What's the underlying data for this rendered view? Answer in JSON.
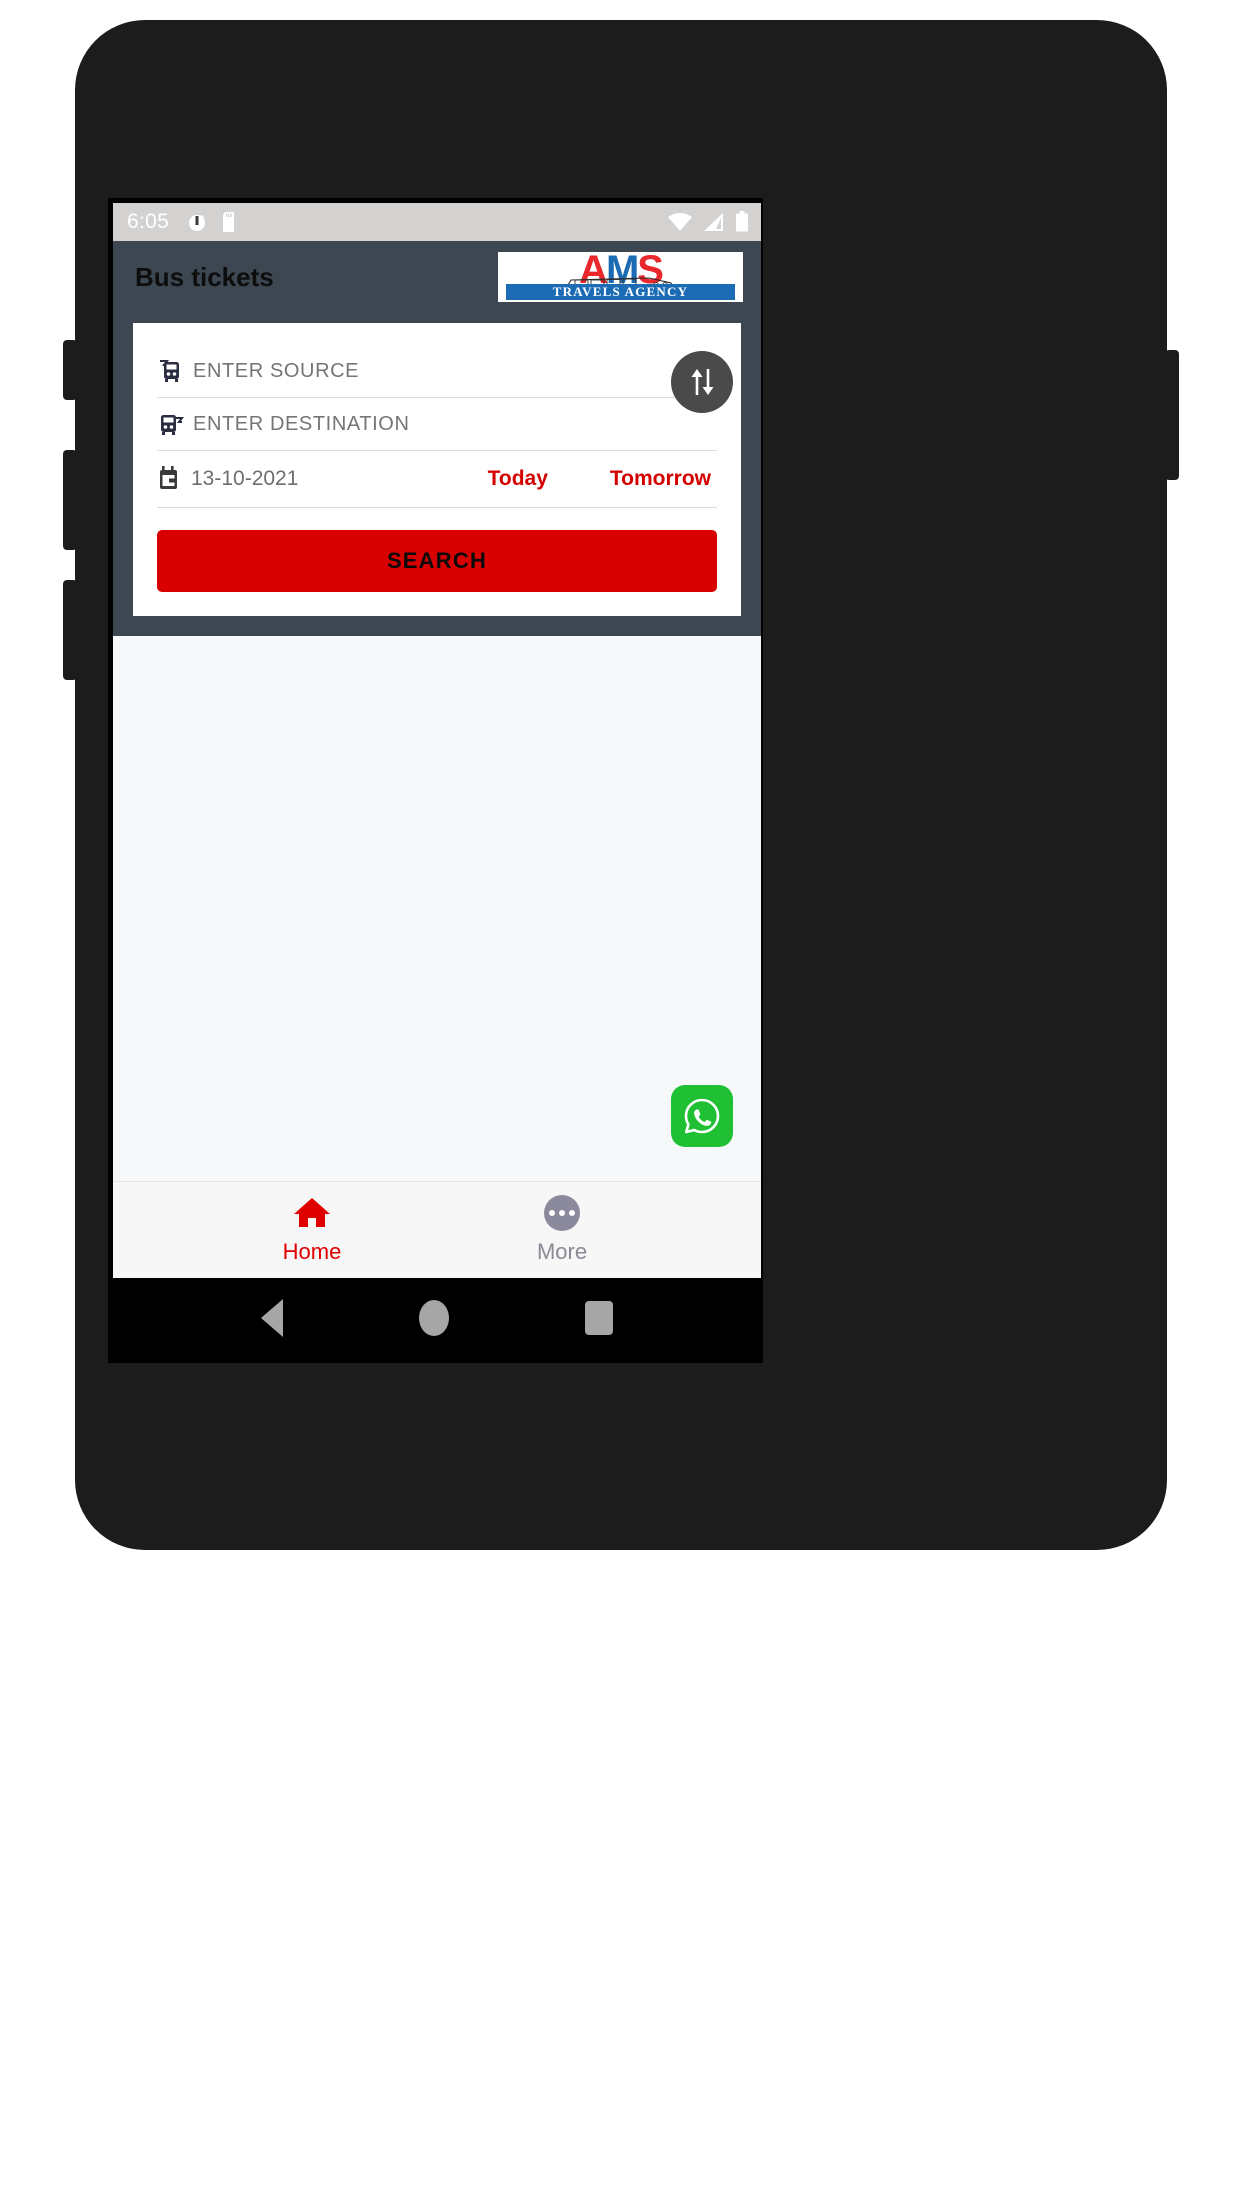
{
  "status_bar": {
    "time": "6:05",
    "left_icons": [
      "alarm-icon",
      "sd-card-icon"
    ],
    "right_icons": [
      "wifi-icon",
      "signal-icon",
      "battery-icon"
    ],
    "background_color": "#d4d2d0"
  },
  "app_bar": {
    "title": "Bus tickets",
    "background_color": "#3d4752",
    "logo": {
      "letters": [
        "A",
        "M",
        "S"
      ],
      "tagline": "TRAVELS AGENCY",
      "letter_colors": [
        "#e8282b",
        "#1b6cb5",
        "#e8282b"
      ],
      "banner_color": "#1b6cb5"
    }
  },
  "search_card": {
    "source": {
      "icon": "bus-arrive-icon",
      "value": "",
      "placeholder": "ENTER SOURCE"
    },
    "destination": {
      "icon": "bus-depart-icon",
      "value": "",
      "placeholder": "ENTER DESTINATION"
    },
    "swap_button": {
      "icon": "swap-vertical-icon",
      "background_color": "#4a4a4a"
    },
    "date": {
      "icon": "calendar-icon",
      "value": "13-10-2021"
    },
    "quick_dates": [
      {
        "label": "Today",
        "color": "#d50000"
      },
      {
        "label": "Tomorrow",
        "color": "#d50000"
      }
    ],
    "search_button": {
      "label": "SEARCH",
      "background_color": "#d80000",
      "text_color": "#0a0a0a"
    }
  },
  "content": {
    "whatsapp_fab": {
      "icon": "whatsapp-icon",
      "background_color": "#20c034"
    }
  },
  "bottom_nav": {
    "items": [
      {
        "label": "Home",
        "icon": "home-icon",
        "active": true,
        "color": "#e00000"
      },
      {
        "label": "More",
        "icon": "more-dots-icon",
        "active": false,
        "color": "#8a8a96"
      }
    ]
  },
  "system_nav": {
    "buttons": [
      "back-icon",
      "home-circle-icon",
      "recents-square-icon"
    ]
  }
}
